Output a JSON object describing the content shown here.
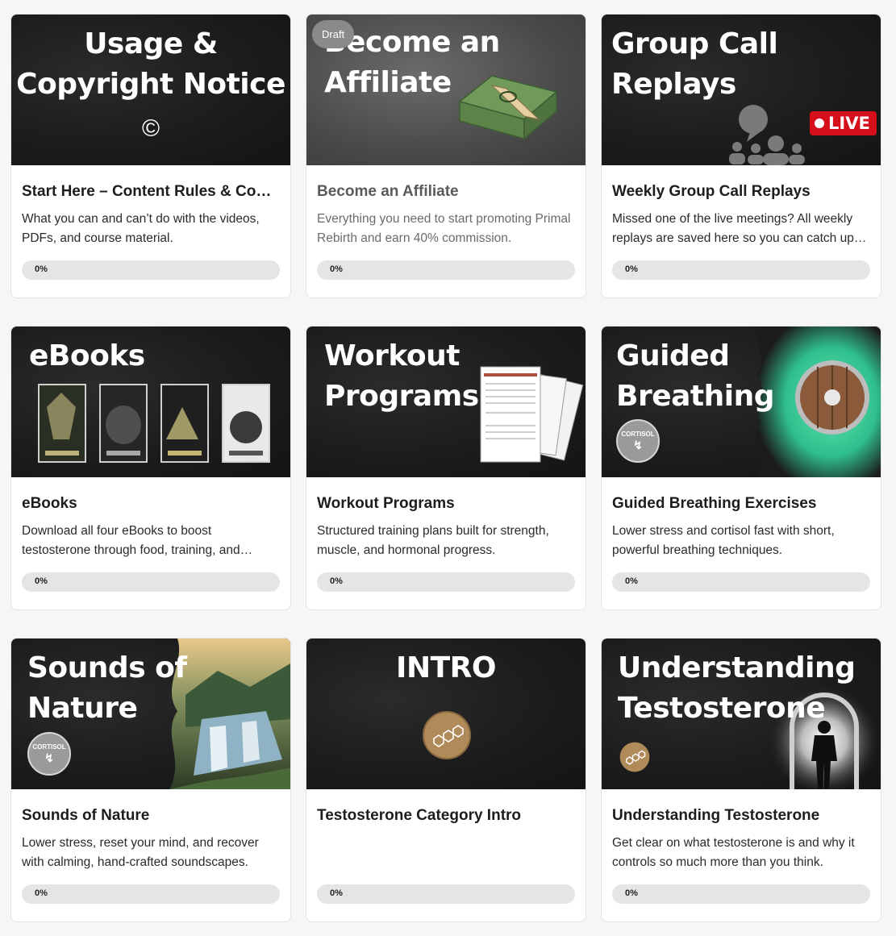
{
  "cards": [
    {
      "thumb_title": "Usage &\nCopyright Notice",
      "title": "Start Here – Content Rules & Copyright",
      "description": "What you can and can’t do with the videos, PDFs, and course material.",
      "progress": 0,
      "progress_label": "0%"
    },
    {
      "thumb_title": "Become an\nAffiliate",
      "badge": "Draft",
      "title": "Become an Affiliate",
      "description": "Everything you need to start promoting Primal Rebirth and earn 40% commission.",
      "progress": 0,
      "progress_label": "0%"
    },
    {
      "thumb_title": "Group Call\nReplays",
      "live_badge": "LIVE",
      "title": "Weekly Group Call Replays",
      "description": "Missed one of the live meetings? All weekly replays are saved here so you can catch up anytime.",
      "progress": 0,
      "progress_label": "0%"
    },
    {
      "thumb_title": "eBooks",
      "title": "eBooks",
      "description": "Download all four eBooks to boost testosterone through food, training, and mindset.",
      "progress": 0,
      "progress_label": "0%"
    },
    {
      "thumb_title": "Workout\nPrograms",
      "title": "Workout Programs",
      "description": "Structured training plans built for strength, muscle, and hormonal progress.",
      "progress": 0,
      "progress_label": "0%"
    },
    {
      "thumb_title": "Guided\nBreathing",
      "cortisol_label": "CORTISOL",
      "title": "Guided Breathing Exercises",
      "description": "Lower stress and cortisol fast with short, powerful breathing techniques.",
      "progress": 0,
      "progress_label": "0%"
    },
    {
      "thumb_title": "Sounds of\nNature",
      "cortisol_label": "CORTISOL",
      "title": "Sounds of Nature",
      "description": "Lower stress, reset your mind, and recover with calming, hand-crafted soundscapes.",
      "progress": 0,
      "progress_label": "0%"
    },
    {
      "thumb_title": "INTRO",
      "title": "Testosterone Category Intro",
      "description": "",
      "progress": 0,
      "progress_label": "0%"
    },
    {
      "thumb_title": "Understanding\nTestosterone",
      "title": "Understanding Testosterone",
      "description": "Get clear on what testosterone is and why it controls so much more than you think.",
      "progress": 0,
      "progress_label": "0%"
    }
  ],
  "colors": {
    "live_red": "#d5101b",
    "progress_track": "#e5e5e5",
    "thumb_dark": "#1c1c1c",
    "bronze": "#b08a58",
    "mist_green": "#3fd6a4"
  }
}
